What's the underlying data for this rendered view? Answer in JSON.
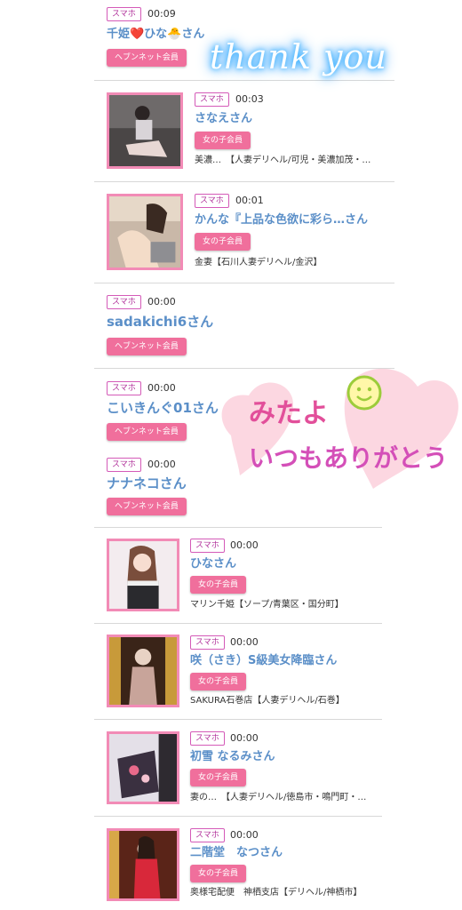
{
  "entries": [
    {
      "tag": "スマホ",
      "time": "00:09",
      "name": "千姫❤️ひな🐣さん",
      "badge": "ヘブンネット会員"
    },
    {
      "tag": "スマホ",
      "time": "00:03",
      "name": "さなえさん",
      "badge": "女の子会員",
      "shop": "美濃…　【人妻デリヘル/可児・美濃加茂・…"
    },
    {
      "tag": "スマホ",
      "time": "00:01",
      "name": "かんな『上品な色欲に彩ら…さん",
      "badge": "女の子会員",
      "shop": "金妻【石川人妻デリヘル/金沢】"
    },
    {
      "tag": "スマホ",
      "time": "00:00",
      "name": "sadakichi6さん",
      "badge": "ヘブンネット会員"
    },
    {
      "tag": "スマホ",
      "time": "00:00",
      "name": "こいきんぐ01さん",
      "badge": "ヘブンネット会員"
    },
    {
      "tag": "スマホ",
      "time": "00:00",
      "name": "ナナネコさん",
      "badge": "ヘブンネット会員"
    },
    {
      "tag": "スマホ",
      "time": "00:00",
      "name": "ひなさん",
      "badge": "女の子会員",
      "shop": "マリン千姫【ソープ/青葉区・国分町】"
    },
    {
      "tag": "スマホ",
      "time": "00:00",
      "name": "咲（さき）S級美女降臨さん",
      "badge": "女の子会員",
      "shop": "SAKURA石巻店【人妻デリヘル/石巻】"
    },
    {
      "tag": "スマホ",
      "time": "00:00",
      "name": "初雪 なるみさん",
      "badge": "女の子会員",
      "shop": "妻の…　【人妻デリヘル/徳島市・鳴門町・…"
    },
    {
      "tag": "スマホ",
      "time": "00:00",
      "name": "二階堂　なつさん",
      "badge": "女の子会員",
      "shop": "奥様宅配便　神栖支店【デリヘル/神栖市】"
    }
  ],
  "stickers": {
    "thank_you": "thank you",
    "mitayo_line1": "みたよ",
    "mitayo_line2": "いつもありがとう"
  },
  "colors": {
    "name": "#5b8fc8",
    "badge": "#f06f9c",
    "tag_border": "#d45ab8",
    "thumb_border": "#f28bb6"
  }
}
